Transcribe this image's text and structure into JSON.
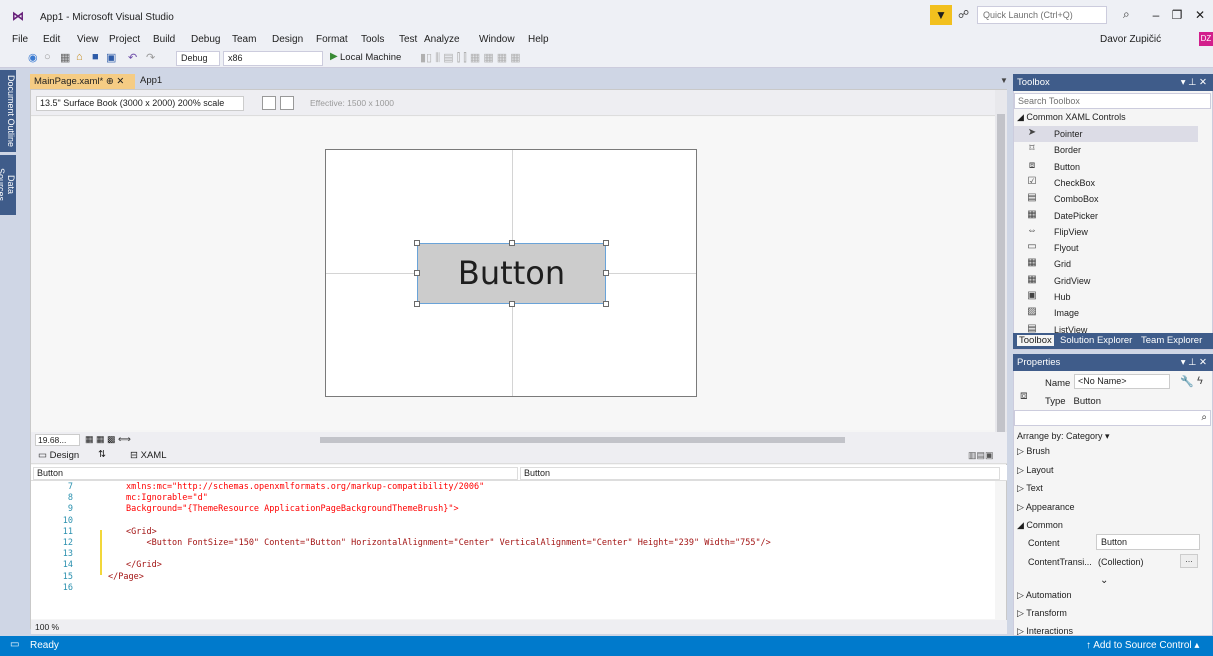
{
  "window": {
    "title": "App1 - Microsoft Visual Studio",
    "quick_launch_placeholder": "Quick Launch (Ctrl+Q)",
    "user_name": "Davor Zupičić",
    "user_initials": "DZ"
  },
  "menu": [
    "File",
    "Edit",
    "View",
    "Project",
    "Build",
    "Debug",
    "Team",
    "Design",
    "Format",
    "Tools",
    "Test",
    "Analyze",
    "Window",
    "Help"
  ],
  "toolbar": {
    "config": "Debug",
    "platform": "x86",
    "run_target": "Local Machine"
  },
  "left_tabs": [
    "Document Outline",
    "Data Sources"
  ],
  "doc_tabs": {
    "active": "MainPage.xaml*",
    "other": "App1"
  },
  "designer": {
    "device": "13.5\" Surface Book (3000 x 2000) 200% scale",
    "effective": "Effective: 1500 x 1000",
    "button_text": "Button",
    "zoom": "19.68...",
    "code_zoom": "100 %"
  },
  "split_tabs": {
    "design": "Design",
    "xaml": "XAML"
  },
  "nav": {
    "left": "Button",
    "right": "Button"
  },
  "code": {
    "lines": [
      {
        "no": "7",
        "text": "xmlns:mc=\"http://schemas.openxmlformats.org/markup-compatibility/2006\""
      },
      {
        "no": "8",
        "text": "mc:Ignorable=\"d\""
      },
      {
        "no": "9",
        "text": "Background=\"{ThemeResource ApplicationPageBackgroundThemeBrush}\">"
      },
      {
        "no": "10",
        "text": ""
      },
      {
        "no": "11",
        "text": "<Grid>"
      },
      {
        "no": "12",
        "text": "    <Button FontSize=\"150\" Content=\"Button\" HorizontalAlignment=\"Center\" VerticalAlignment=\"Center\" Height=\"239\" Width=\"755\"/>"
      },
      {
        "no": "13",
        "text": ""
      },
      {
        "no": "14",
        "text": "</Grid>"
      },
      {
        "no": "15",
        "text": "</Page>"
      },
      {
        "no": "16",
        "text": ""
      }
    ]
  },
  "toolbox": {
    "title": "Toolbox",
    "search_placeholder": "Search Toolbox",
    "group": "◢ Common XAML Controls",
    "items": [
      "Pointer",
      "Border",
      "Button",
      "CheckBox",
      "ComboBox",
      "DatePicker",
      "FlipView",
      "Flyout",
      "Grid",
      "GridView",
      "Hub",
      "Image",
      "ListView"
    ],
    "tabs": [
      "Toolbox",
      "Solution Explorer",
      "Team Explorer"
    ]
  },
  "properties": {
    "title": "Properties",
    "name_label": "Name",
    "name_value": "<No Name>",
    "type_label": "Type",
    "type_value": "Button",
    "arrange": "Arrange by: Category ▾",
    "categories": [
      "▷ Brush",
      "▷ Layout",
      "▷ Text",
      "▷ Appearance",
      "◢ Common"
    ],
    "content_label": "Content",
    "content_value": "Button",
    "contenttrans_label": "ContentTransi...",
    "contenttrans_value": "(Collection)",
    "more_categories": [
      "▷ Automation",
      "▷ Transform",
      "▷ Interactions"
    ]
  },
  "status": {
    "ready": "Ready",
    "source_control": "↑ Add to Source Control ▴"
  }
}
